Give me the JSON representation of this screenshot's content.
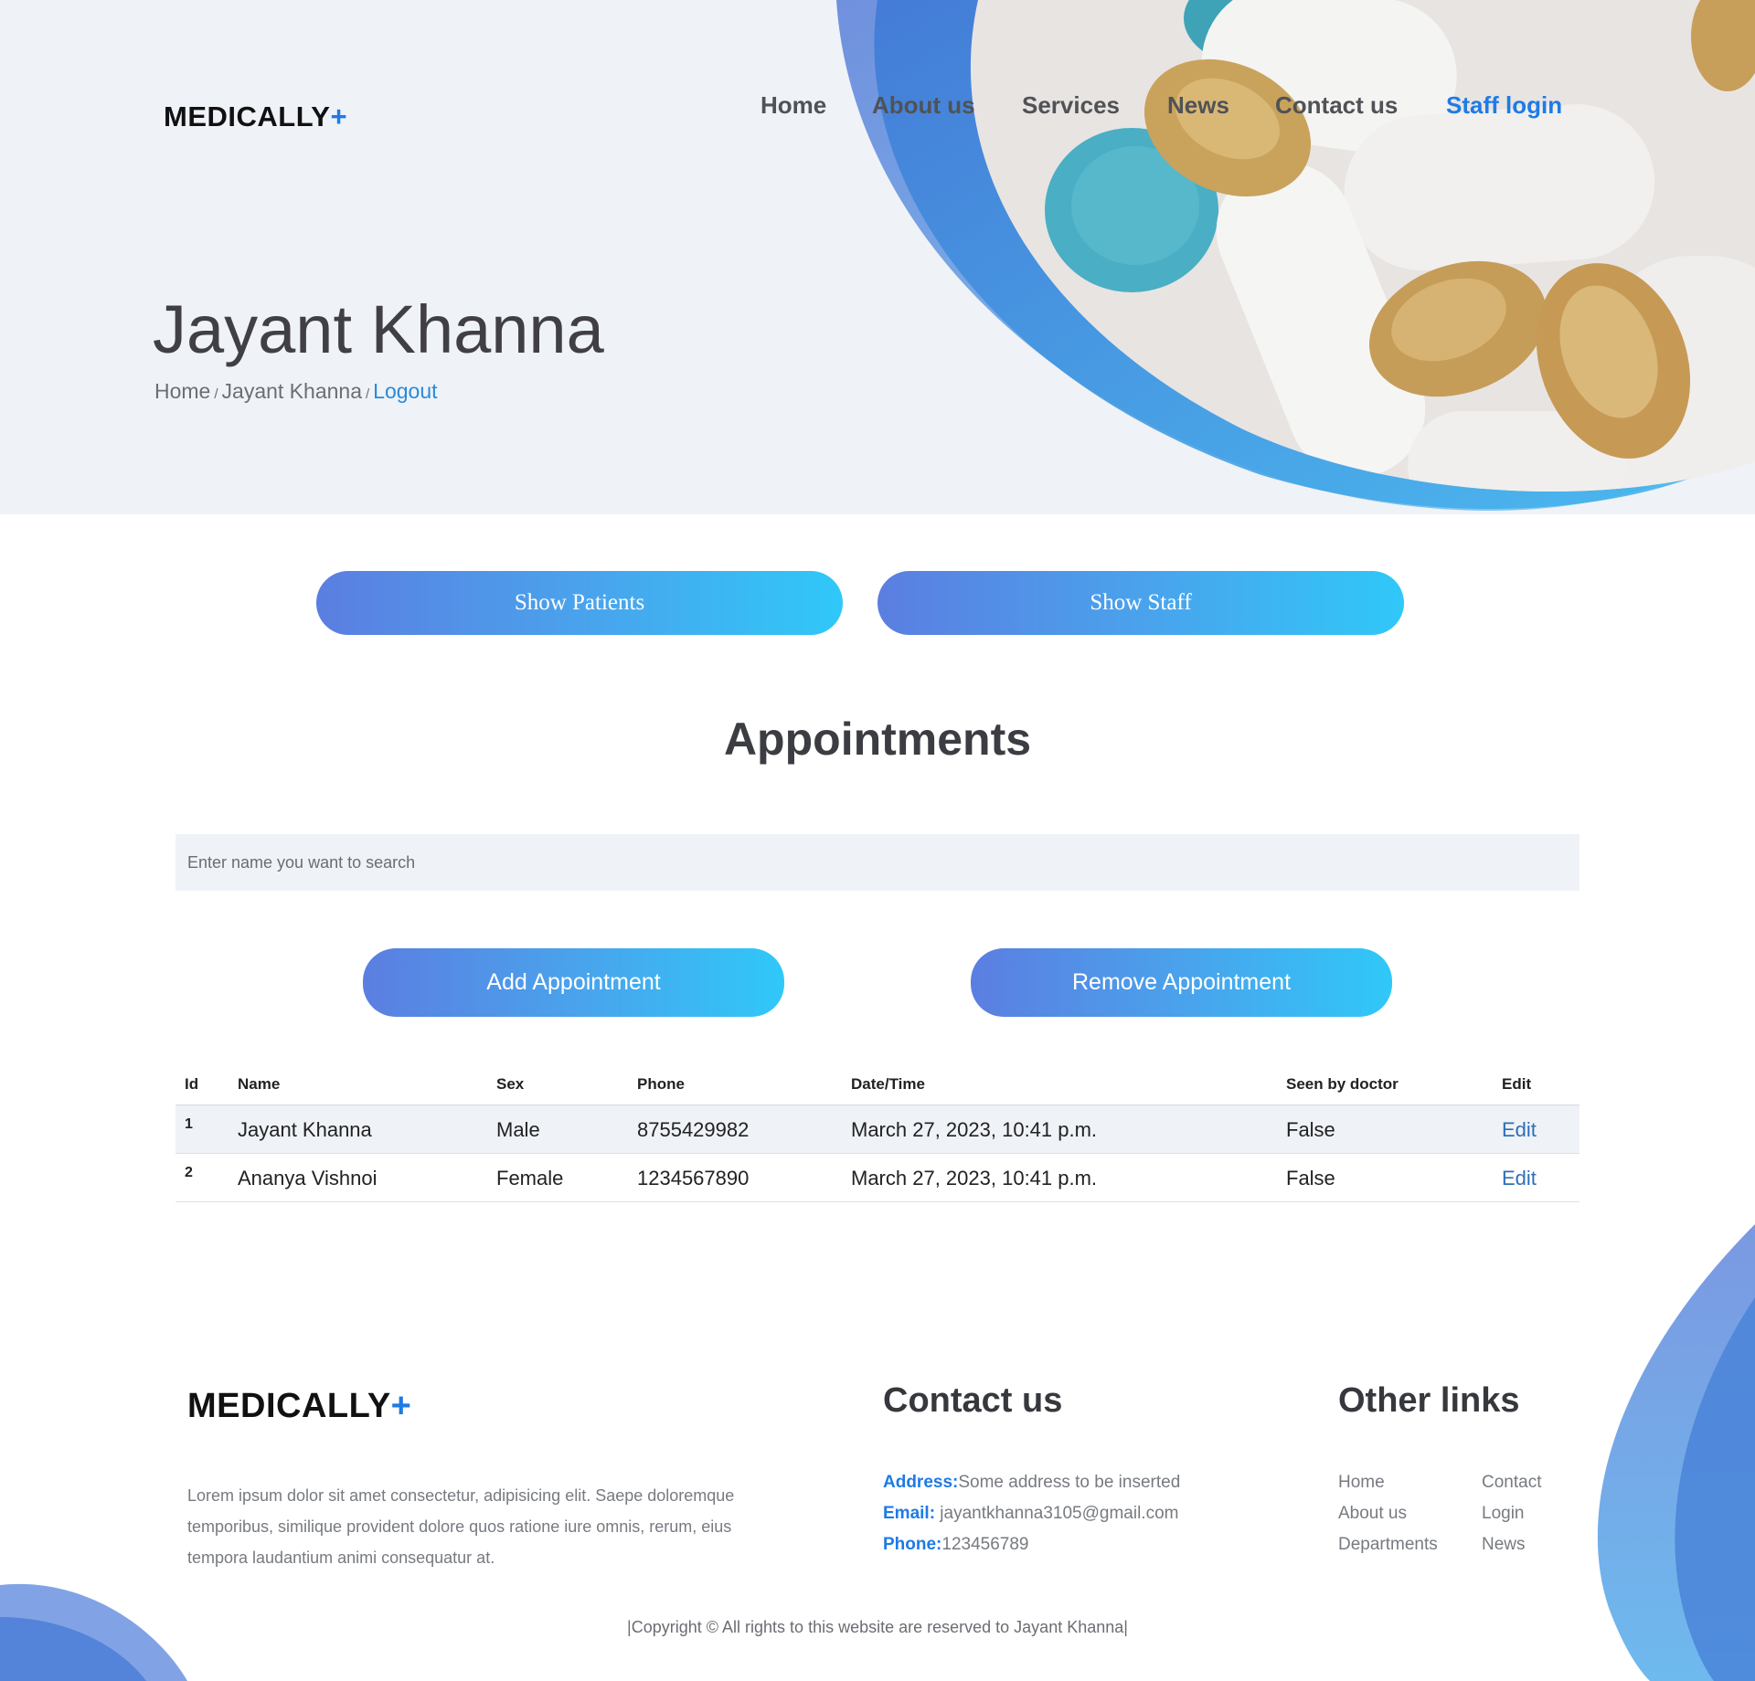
{
  "brand": {
    "name": "MEDICALLY",
    "plus": "+"
  },
  "nav": {
    "home": "Home",
    "about": "About us",
    "services": "Services",
    "news": "News",
    "contact": "Contact us",
    "staff_login": "Staff login"
  },
  "hero": {
    "title": "Jayant Khanna",
    "breadcrumb": {
      "home": "Home",
      "sep": "/",
      "current": "Jayant Khanna",
      "logout": "Logout"
    }
  },
  "actions": {
    "show_patients": "Show Patients",
    "show_staff": "Show Staff"
  },
  "appointments": {
    "title": "Appointments",
    "search_placeholder": "Enter name you want to search",
    "add_label": "Add Appointment",
    "remove_label": "Remove Appointment",
    "columns": [
      "Id",
      "Name",
      "Sex",
      "Phone",
      "Date/Time",
      "Seen by doctor",
      "Edit"
    ],
    "rows": [
      {
        "id": "1",
        "name": "Jayant Khanna",
        "sex": "Male",
        "phone": "8755429982",
        "datetime": "March 27, 2023, 10:41 p.m.",
        "seen": "False",
        "edit": "Edit"
      },
      {
        "id": "2",
        "name": "Ananya Vishnoi",
        "sex": "Female",
        "phone": "1234567890",
        "datetime": "March 27, 2023, 10:41 p.m.",
        "seen": "False",
        "edit": "Edit"
      }
    ]
  },
  "footer": {
    "about_text": "Lorem ipsum dolor sit amet consectetur, adipisicing elit. Saepe doloremque temporibus, similique provident dolore quos ratione iure omnis, rerum, eius tempora laudantium animi consequatur at.",
    "contact_title": "Contact us",
    "address_label": "Address:",
    "address_value": "Some address to be inserted",
    "email_label": "Email:",
    "email_value": " jayantkhanna3105@gmail.com",
    "phone_label": "Phone:",
    "phone_value": "123456789",
    "links_title": "Other links",
    "links": [
      "Home",
      "About us",
      "Departments",
      "Contact",
      "Login",
      "News"
    ],
    "copyright": "|Copyright © All rights to this website are reserved to Jayant Khanna|"
  },
  "colors": {
    "accent": "#1e7be5",
    "gradient_start": "#5b7ee1",
    "gradient_end": "#30c8f8",
    "panel_bg": "#eff2f7"
  }
}
